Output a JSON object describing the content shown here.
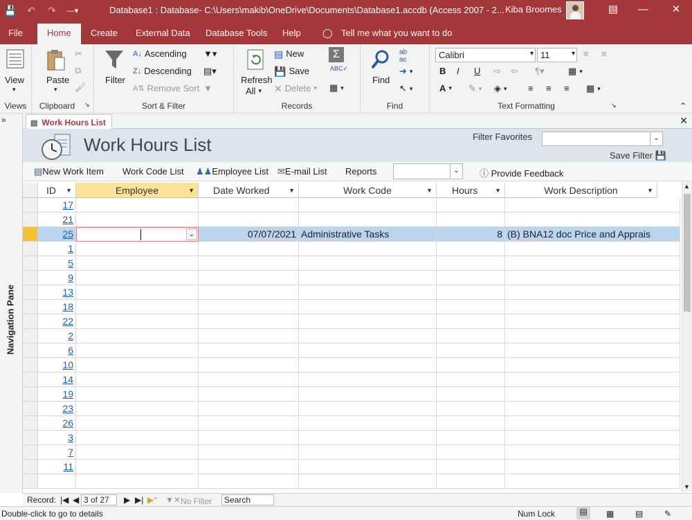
{
  "title_bar": {
    "title": "Database1 : Database- C:\\Users\\makib\\OneDrive\\Documents\\Database1.accdb (Access 2007 - 2...",
    "user": "Kiba Broomes"
  },
  "tabs": [
    "File",
    "Home",
    "Create",
    "External Data",
    "Database Tools",
    "Help"
  ],
  "tell_me": "Tell me what you want to do",
  "ribbon": {
    "views": {
      "view": "View",
      "group": "Views"
    },
    "clipboard": {
      "paste": "Paste",
      "group": "Clipboard"
    },
    "sort_filter": {
      "filter": "Filter",
      "ascending": "Ascending",
      "descending": "Descending",
      "remove_sort": "Remove Sort",
      "group": "Sort & Filter"
    },
    "records": {
      "refresh": "Refresh",
      "refresh2": "All",
      "new": "New",
      "save": "Save",
      "delete": "Delete",
      "group": "Records"
    },
    "find": {
      "find": "Find",
      "group": "Find"
    },
    "text_formatting": {
      "font": "Calibri",
      "size": "11",
      "bold": "B",
      "italic": "I",
      "underline": "U",
      "font_color": "A",
      "group": "Text Formatting"
    }
  },
  "nav_pane": {
    "label": "Navigation Pane"
  },
  "doc_tab": {
    "label": "Work Hours List"
  },
  "form": {
    "title": "Work Hours List",
    "filter_favorites": "Filter Favorites",
    "save_filter": "Save Filter",
    "toolbar": {
      "new_work_item": "New Work Item",
      "work_code_list": "Work Code List",
      "employee_list": "Employee List",
      "email_list": "E-mail List",
      "reports": "Reports",
      "provide_feedback": "Provide Feedback"
    }
  },
  "columns": [
    "ID",
    "Employee",
    "Date Worked",
    "Work Code",
    "Hours",
    "Work Description"
  ],
  "rows": [
    {
      "id": "17"
    },
    {
      "id": "21"
    },
    {
      "id": "25",
      "employee": "",
      "date": "07/07/2021",
      "code": "Administrative Tasks",
      "hours": "8",
      "desc": "(B) BNA12 doc Price and Apprais"
    },
    {
      "id": "1"
    },
    {
      "id": "5"
    },
    {
      "id": "9"
    },
    {
      "id": "13"
    },
    {
      "id": "18"
    },
    {
      "id": "22"
    },
    {
      "id": "2"
    },
    {
      "id": "6"
    },
    {
      "id": "10"
    },
    {
      "id": "14"
    },
    {
      "id": "19"
    },
    {
      "id": "23"
    },
    {
      "id": "26"
    },
    {
      "id": "3"
    },
    {
      "id": "7"
    },
    {
      "id": "11"
    }
  ],
  "record_nav": {
    "label": "Record:",
    "current": "3 of 27",
    "no_filter": "No Filter",
    "search": "Search"
  },
  "status": {
    "hint": "Double-click to go to details",
    "num_lock": "Num Lock"
  },
  "colors": {
    "accent": "#a4373a",
    "selection": "#bcd5ee",
    "current_row": "#f2c230"
  }
}
